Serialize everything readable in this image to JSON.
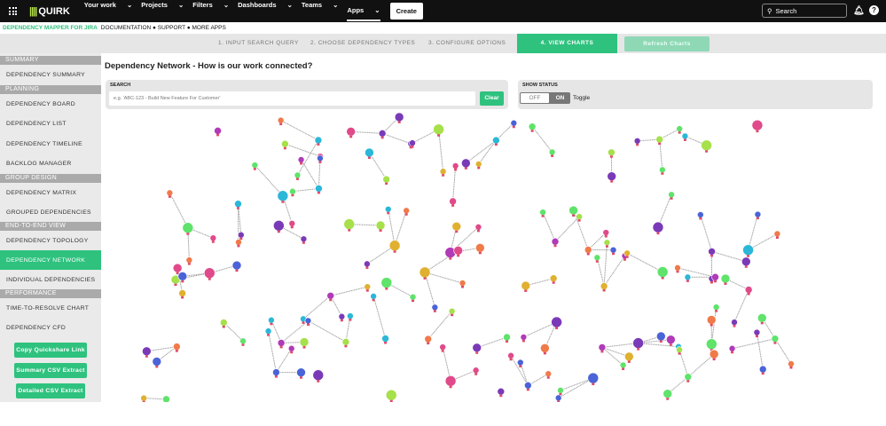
{
  "topbar": {
    "logo": "QUIRK",
    "nav": [
      "Your work",
      "Projects",
      "Filters",
      "Dashboards",
      "Teams",
      "Apps"
    ],
    "create": "Create",
    "search_placeholder": "Search"
  },
  "subbar": {
    "brand": "DEPENDENCY MAPPER FOR JIRA",
    "links": "DOCUMENTATION ● SUPPORT ● MORE APPS"
  },
  "steps": [
    "1. INPUT SEARCH QUERY",
    "2. CHOOSE DEPENDENCY TYPES",
    "3. CONFIGURE OPTIONS",
    "4. VIEW CHARTS"
  ],
  "refresh": "Refresh Charts",
  "sidebar": {
    "sections": {
      "summary": "SUMMARY",
      "planning": "PLANNING",
      "group": "GROUP DESIGN",
      "e2e": "END-TO-END VIEW",
      "perf": "PERFORMANCE"
    },
    "items": [
      "DEPENDENCY SUMMARY",
      "DEPENDENCY BOARD",
      "DEPENDENCY LIST",
      "DEPENDENCY TIMELINE",
      "BACKLOG MANAGER",
      "DEPENDENCY MATRIX",
      "GROUPED DEPENDENCIES",
      "DEPENDENCY TOPOLOGY",
      "DEPENDENCY NETWORK",
      "INDIVIDUAL DEPENDENCIES",
      "TIME-TO-RESOLVE CHART",
      "DEPENDENCY CFD"
    ],
    "buttons": [
      "Copy Quickshare Link",
      "Summary CSV Extract",
      "Detailed CSV Extract"
    ]
  },
  "main": {
    "title": "Dependency Network - How is our work connected?",
    "search_label": "SEARCH",
    "search_placeholder": "e.g. 'ABC-123 - Build New Feature For Customer'",
    "clear": "Clear",
    "status_label": "SHOW STATUS",
    "off": "OFF",
    "on": "ON",
    "toggle": "Toggle"
  },
  "colors": {
    "accent": "#2ec27e",
    "nodes": [
      "#4a63d8",
      "#5fe36a",
      "#a6e04a",
      "#f07a4a",
      "#b03ab8",
      "#7a3ab8",
      "#2bb7d8",
      "#e0b030",
      "#e04a8a"
    ]
  }
}
